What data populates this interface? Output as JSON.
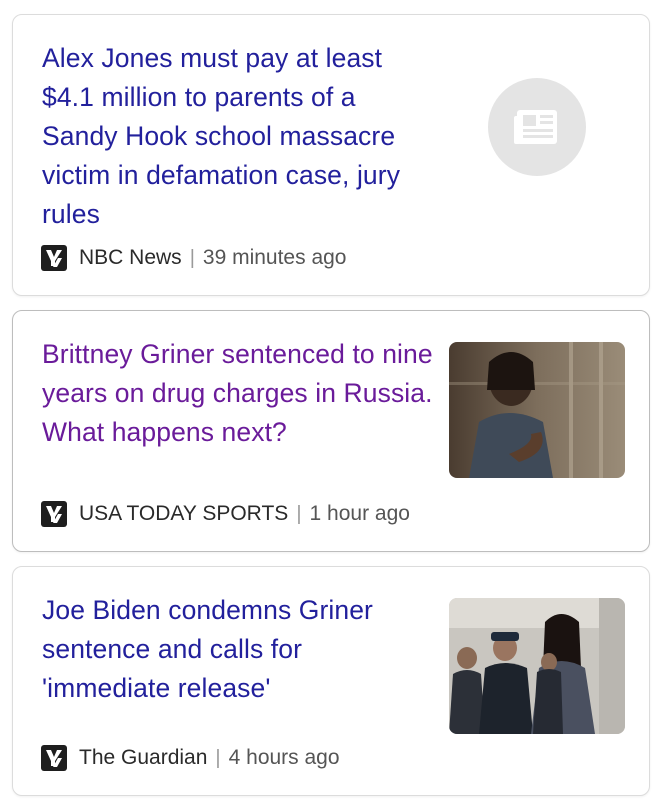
{
  "articles": [
    {
      "headline": "Alex Jones must pay at least $4.1 million to parents of a Sandy Hook school massacre victim in defamation case, jury rules",
      "source": "NBC News",
      "separator": "|",
      "time": "39 minutes ago",
      "thumbnail_icon": "newspaper-icon",
      "headline_color": "#22209c"
    },
    {
      "headline": "Brittney Griner sentenced to nine years on drug charges in Russia. What happens next?",
      "source": "USA TODAY SPORTS",
      "separator": "|",
      "time": "1 hour ago",
      "headline_color": "#6a1b9a"
    },
    {
      "headline": "Joe Biden condemns Griner sentence and calls for 'immediate release'",
      "source": "The Guardian",
      "separator": "|",
      "time": "4 hours ago",
      "headline_color": "#22209c"
    }
  ],
  "colors": {
    "unvisited_link": "#22209c",
    "visited_link": "#6a1b9a",
    "card_border": "#dcdcdc",
    "placeholder_bg": "#e4e4e4"
  }
}
